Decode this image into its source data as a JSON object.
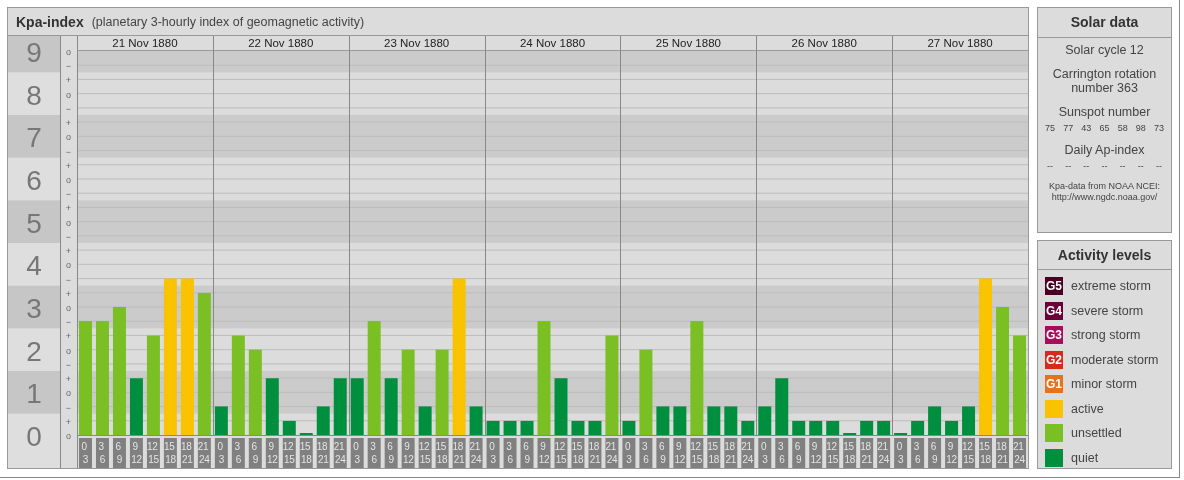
{
  "kpa_panel": {
    "title": "Kpa-index",
    "subtitle": "(planetary 3-hourly index of geomagnetic activity)",
    "days": [
      "21 Nov 1880",
      "22 Nov 1880",
      "23 Nov 1880",
      "24 Nov 1880",
      "25 Nov 1880",
      "26 Nov 1880",
      "27 Nov 1880"
    ],
    "scale_marks": [
      "o",
      "−",
      "+",
      "o",
      "−",
      "+",
      "o",
      "−",
      "+",
      "o",
      "−",
      "+",
      "o",
      "−",
      "+",
      "o",
      "−",
      "+",
      "o",
      "−",
      "+",
      "o",
      "−",
      "+",
      "o",
      "−",
      "+",
      "o"
    ],
    "chart_data": {
      "type": "bar",
      "grid": true,
      "ylim": [
        0,
        9
      ],
      "yticks": [
        0,
        1,
        2,
        3,
        4,
        5,
        6,
        7,
        8,
        9
      ],
      "categories": [
        "0\n3",
        "3\n6",
        "6\n9",
        "9\n12",
        "12\n15",
        "15\n18",
        "18\n21",
        "21\n24",
        "0\n3",
        "3\n6",
        "6\n9",
        "9\n12",
        "12\n15",
        "15\n18",
        "18\n21",
        "21\n24",
        "0\n3",
        "3\n6",
        "6\n9",
        "9\n12",
        "12\n15",
        "15\n18",
        "18\n21",
        "21\n24",
        "0\n3",
        "3\n6",
        "6\n9",
        "9\n12",
        "12\n15",
        "15\n18",
        "18\n21",
        "21\n24",
        "0\n3",
        "3\n6",
        "6\n9",
        "9\n12",
        "12\n15",
        "15\n18",
        "18\n21",
        "21\n24",
        "0\n3",
        "3\n6",
        "6\n9",
        "9\n12",
        "12\n15",
        "15\n18",
        "18\n21",
        "21\n24",
        "0\n3",
        "3\n6",
        "6\n9",
        "9\n12",
        "12\n15",
        "15\n18",
        "18\n21",
        "21\n24"
      ],
      "series": [
        {
          "name": "quiet",
          "color": "#008f3e",
          "values": [
            null,
            null,
            null,
            1.33,
            null,
            null,
            null,
            null,
            0.67,
            null,
            null,
            1.33,
            0.33,
            0,
            0.67,
            1.33,
            1.33,
            null,
            1.33,
            null,
            0.67,
            null,
            null,
            0.67,
            0.33,
            0.33,
            0.33,
            null,
            1.33,
            0.33,
            0.33,
            null,
            0.33,
            null,
            0.67,
            0.67,
            null,
            0.67,
            0.67,
            0.33,
            0.67,
            1.33,
            0.33,
            0.33,
            0.33,
            0,
            0.33,
            0.33,
            0,
            0.33,
            0.67,
            0.33,
            0.67,
            null,
            null,
            null
          ]
        },
        {
          "name": "unsettled",
          "color": "#7abf23",
          "values": [
            2.67,
            2.67,
            3,
            null,
            2.33,
            null,
            null,
            3.33,
            null,
            2.33,
            2,
            null,
            null,
            null,
            null,
            null,
            null,
            2.67,
            null,
            2,
            null,
            2,
            null,
            null,
            null,
            null,
            null,
            2.67,
            null,
            null,
            null,
            2.33,
            null,
            2,
            null,
            null,
            2.67,
            null,
            null,
            null,
            null,
            null,
            null,
            null,
            null,
            null,
            null,
            null,
            null,
            null,
            null,
            null,
            null,
            null,
            3,
            2.33
          ]
        },
        {
          "name": "active",
          "color": "#f9c300",
          "values": [
            null,
            null,
            null,
            null,
            null,
            3.67,
            3.67,
            null,
            null,
            null,
            null,
            null,
            null,
            null,
            null,
            null,
            null,
            null,
            null,
            null,
            null,
            null,
            3.67,
            null,
            null,
            null,
            null,
            null,
            null,
            null,
            null,
            null,
            null,
            null,
            null,
            null,
            null,
            null,
            null,
            null,
            null,
            null,
            null,
            null,
            null,
            null,
            null,
            null,
            null,
            null,
            null,
            null,
            null,
            3.67,
            null,
            null
          ]
        }
      ]
    }
  },
  "solar_data": {
    "title": "Solar data",
    "cycle": "Solar cycle 12",
    "rotation": "Carrington rotation number 363",
    "sunspot_heading": "Sunspot number",
    "sunspot_numbers": [
      "75",
      "77",
      "43",
      "65",
      "58",
      "98",
      "73"
    ],
    "ap_heading": "Daily Ap-index",
    "ap_values": [
      "--",
      "--",
      "--",
      "--",
      "--",
      "--",
      "--"
    ],
    "source": "Kpa-data from NOAA NCEI:",
    "source_url": "http://www.ngdc.noaa.gov/"
  },
  "activity_levels": {
    "title": "Activity levels",
    "items": [
      {
        "badge": "G5",
        "label": "extreme storm",
        "color": "#4a0023"
      },
      {
        "badge": "G4",
        "label": "severe storm",
        "color": "#6a0037"
      },
      {
        "badge": "G3",
        "label": "strong storm",
        "color": "#a80c5c"
      },
      {
        "badge": "G2",
        "label": "moderate storm",
        "color": "#d62a1e"
      },
      {
        "badge": "G1",
        "label": "minor storm",
        "color": "#e6731c"
      }
    ]
  }
}
